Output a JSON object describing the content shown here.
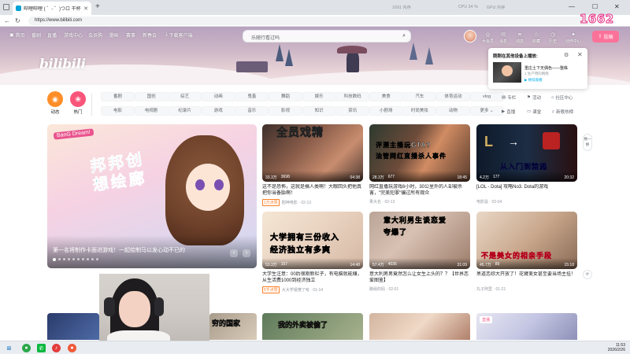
{
  "browser": {
    "tab_title": "哔哩哔哩 ( ゜- ゜)つロ 干杯~-bilibili",
    "new_tab": "+",
    "url": "https://www.bilibili.com",
    "stats": {
      "mem": "1691 内存",
      "cpu_label": "CPU 34 %",
      "gpu_label": "GPU 内存",
      "other": "50%"
    },
    "counter": "1662"
  },
  "topnav": {
    "items": [
      "首页",
      "番剧",
      "直播",
      "游戏中心",
      "会员购",
      "漫画",
      "赛事",
      "新春会",
      "下载客户端"
    ]
  },
  "search": {
    "placeholder": "乐随行看过吗"
  },
  "right_nav": [
    "大会员",
    "消息",
    "动态",
    "收藏",
    "历史",
    "创作中心"
  ],
  "upload_label": "投稿",
  "logo": "bilibili",
  "popup": {
    "title": "刚刚在其他设备上播放:",
    "video_name": "重庄土下无偶色——整蛛",
    "meta": "1 生产用的网络",
    "go": "▶ 继续观看"
  },
  "channels_big": [
    {
      "label": "动态",
      "color": "#ff8e29",
      "icon": "◉"
    },
    {
      "label": "热门",
      "color": "#f9557b",
      "icon": "❀"
    }
  ],
  "chips_row1": [
    "番剧",
    "国创",
    "综艺",
    "动画",
    "鬼畜",
    "舞蹈",
    "娱乐",
    "科技数码",
    "美食",
    "汽车",
    "体育运动",
    "vlog"
  ],
  "chips_row2": [
    "电影",
    "电视剧",
    "纪录片",
    "游戏",
    "音乐",
    "影视",
    "知识",
    "资讯",
    "小剧场",
    "时尚美妆",
    "动物",
    "更多 ⌄"
  ],
  "right_links_row1": [
    "专栏",
    "活动",
    "社区中心"
  ],
  "right_links_row2": [
    "直播",
    "课堂",
    "新歌热榜"
  ],
  "carousel": {
    "brand": "BanG Dream!",
    "title": "邦邦创想绘廊",
    "caption": "第一名将制作卡面进游戏！一起绘制马以发心动不已的",
    "slides": 10
  },
  "videos": [
    {
      "big": "全员戏精",
      "views": "33.3万",
      "danmaku": "3698",
      "duration": "04:38",
      "title": "这不是恐怖，这就是搞人类啊！大眼回头把他真把你当备胎啊！",
      "tag": "1万点赞",
      "up": "剧神电影 · 02-13"
    },
    {
      "big": "评测主播玩GTA?\n油管网红直播杀人事件",
      "views": "28.3万",
      "danmaku": "677",
      "duration": "18:45",
      "title": "网红直播玩游戏6小时，30公里外的人却被杀害，\"完美犯罪\"骗过所有观众",
      "tag": "",
      "up": "果大名 · 02-13"
    },
    {
      "big": "从入门到精通",
      "views": "4.2万",
      "danmaku": "177",
      "duration": "20:32",
      "title": "[LOL - Dota] 攻略No3. Dota的游戏",
      "tag": "",
      "up": "电影鼠 · 02-04"
    },
    {
      "big": "大学拥有三份收入\n经济独立有多爽",
      "views": "53.3万",
      "danmaku": "157",
      "duration": "14:48",
      "title": "大学生注意：00后很刚新栏子，有电脑就能赚，从生活费1000到经济独立",
      "tag": "5千点赞",
      "up": "大大学姐懂了哈 · 01-14"
    },
    {
      "big": "意大利男生谈恋爱\n夸爆了",
      "views": "57.4万",
      "danmaku": "4036",
      "duration": "31:09",
      "title": "意大利男男竟然怎么让女生上头的？？【世界恋爱图鉴】",
      "tag": "",
      "up": "路组的妈 · 02-01"
    },
    {
      "big": "不是美女的相亲手段",
      "views": "45.7万",
      "danmaku": "89",
      "duration": "15:18",
      "title": "黑道恋综大开放了！花臂美女甚至要当场主挂！",
      "tag": "",
      "up": "丸子阿里 · 01-21"
    }
  ],
  "bottom_row": [
    {
      "label": "穷的国家"
    },
    {
      "label": "我的外卖被偷了"
    },
    {
      "label": ""
    },
    {
      "label": "直播"
    }
  ],
  "side_buttons": [
    "换一换",
    "⟳"
  ],
  "clock": {
    "time": "11:53",
    "date": "2026/2/26"
  }
}
